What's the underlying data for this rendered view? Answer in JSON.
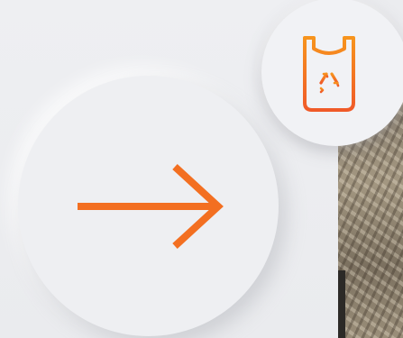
{
  "colors": {
    "accent": "#f36f21",
    "background": "#ebecef",
    "surface": "#eeeff2"
  },
  "nav": {
    "icon": "arrow-right-icon"
  },
  "badge": {
    "icon": "recycle-bag-icon"
  }
}
